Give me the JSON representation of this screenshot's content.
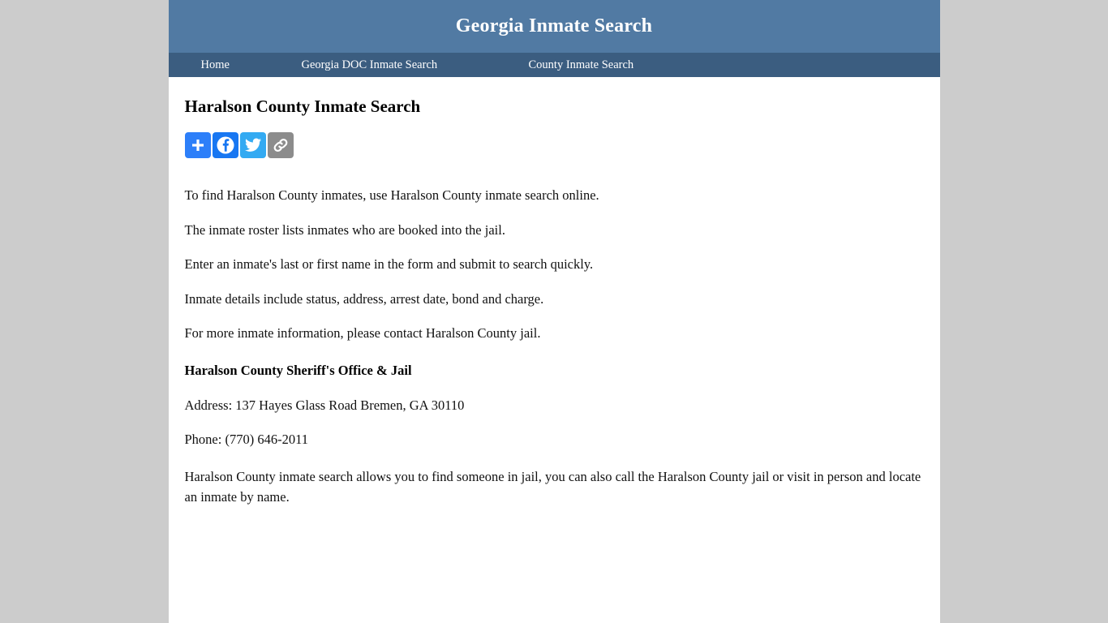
{
  "header": {
    "site_title": "Georgia Inmate Search"
  },
  "nav": {
    "items": [
      {
        "label": "Home",
        "name": "nav-home"
      },
      {
        "label": "Georgia DOC Inmate Search",
        "name": "nav-doc"
      },
      {
        "label": "County Inmate Search",
        "name": "nav-county"
      }
    ]
  },
  "main": {
    "page_title": "Haralson County Inmate Search",
    "share": {
      "buttons": [
        {
          "label": "Share",
          "icon": "plus-icon",
          "color": "#2d7ff9"
        },
        {
          "label": "Facebook",
          "icon": "facebook-icon",
          "color": "#1877f2"
        },
        {
          "label": "Twitter",
          "icon": "twitter-icon",
          "color": "#33aaf2"
        },
        {
          "label": "Copy Link",
          "icon": "link-icon",
          "color": "#8c8c8c"
        }
      ]
    },
    "intro_lines": [
      "To find Haralson County inmates, use Haralson County inmate search online.",
      "The inmate roster lists inmates who are booked into the jail.",
      "Enter an inmate's last or first name in the form and submit to search quickly.",
      "Inmate details include status, address, arrest date, bond and charge.",
      "For more inmate information, please contact Haralson County jail."
    ],
    "contact": {
      "name": "Haralson County Sheriff's Office & Jail",
      "address": "Address: 137 Hayes Glass Road Bremen, GA 30110",
      "phone": "Phone: (770) 646-2011"
    },
    "closing_paragraph": "Haralson County inmate search allows you to find someone in jail, you can also call the Haralson County jail or visit in person and locate an inmate by name."
  },
  "colors": {
    "header_bg": "#517aa3",
    "nav_bg": "#3b5d80",
    "page_bg": "#cccccc",
    "content_bg": "#ffffff"
  }
}
